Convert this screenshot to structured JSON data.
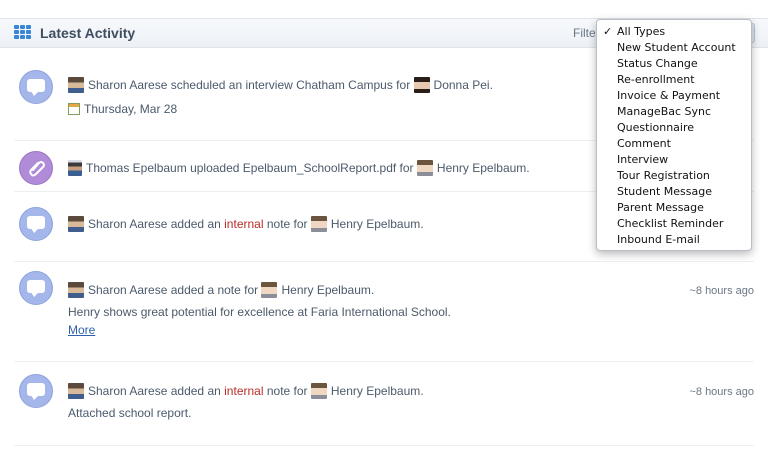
{
  "header": {
    "title": "Latest Activity",
    "filter_label": "Filte"
  },
  "filter_dropdown": {
    "selected": "All Types",
    "options": [
      "All Types",
      "New Student Account",
      "Status Change",
      "Re-enrollment",
      "Invoice & Payment",
      "ManageBac Sync",
      "Questionnaire",
      "Comment",
      "Interview",
      "Tour Registration",
      "Student Message",
      "Parent Message",
      "Checklist Reminder",
      "Inbound E-mail"
    ],
    "check_glyph": "✓"
  },
  "activities": [
    {
      "icon": "chat-bubble-icon",
      "actor": "Sharon Aarese",
      "action": "scheduled an interview Chatham Campus for",
      "target": "Donna Pei.",
      "date": "Thursday, Mar 28"
    },
    {
      "icon": "paperclip-icon",
      "actor": "Thomas Epelbaum",
      "action": "uploaded Epelbaum_SchoolReport.pdf for",
      "target": "Henry Epelbaum."
    },
    {
      "icon": "chat-bubble-icon",
      "actor": "Sharon Aarese",
      "action_pre": "added an",
      "internal": "internal",
      "action_post": "note for",
      "target": "Henry Epelbaum."
    },
    {
      "icon": "chat-bubble-icon",
      "actor": "Sharon Aarese",
      "action": "added a note for",
      "target": "Henry Epelbaum.",
      "time": "~8 hours ago",
      "body": "Henry shows great potential for excellence at Faria International School.",
      "more": "More"
    },
    {
      "icon": "chat-bubble-icon",
      "actor": "Sharon Aarese",
      "action_pre": "added an",
      "internal": "internal",
      "action_post": "note for",
      "target": "Henry Epelbaum.",
      "time": "~8 hours ago",
      "body": "Attached school report."
    }
  ],
  "colors": {
    "accent_blue": "#3a86d6",
    "bubble": "#a5b7ea",
    "attachment_bubble": "#b08cd8",
    "internal_red": "#b92c28",
    "link": "#2e62ad"
  }
}
